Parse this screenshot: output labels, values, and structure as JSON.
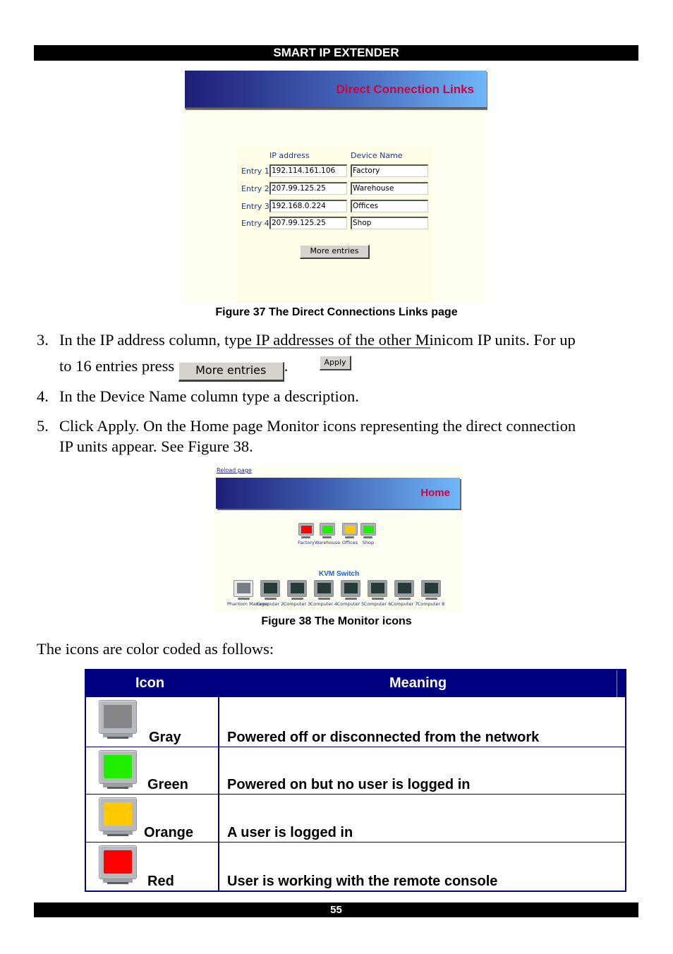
{
  "header": {
    "title": "SMART IP EXTENDER"
  },
  "figure37": {
    "banner_title": "Direct Connection Links",
    "column_headers": {
      "ip": "IP address",
      "name": "Device Name"
    },
    "entries": [
      {
        "label": "Entry 1",
        "ip": "192.114.161.106",
        "name": "Factory"
      },
      {
        "label": "Entry 2",
        "ip": "207.99.125.25",
        "name": "Warehouse"
      },
      {
        "label": "Entry 3",
        "ip": "192.168.0.224",
        "name": "Offices"
      },
      {
        "label": "Entry 4",
        "ip": "207.99.125.25",
        "name": "Shop"
      }
    ],
    "more_entries_label": "More entries",
    "apply_label": "Apply",
    "caption": "Figure 37 The Direct Connections Links page"
  },
  "steps": [
    {
      "number": "3.",
      "text_before": "In the IP address column, type IP addresses of the other Minicom IP units. For up",
      "text_line2": "to 16 entries press",
      "button_label": "More entries",
      "text_after": "."
    },
    {
      "number": "4.",
      "text": "In the Device Name column type a description."
    },
    {
      "number": "5.",
      "text_line1": "Click Apply. On the Home page Monitor icons representing the direct connection",
      "text_line2": "IP units appear. See Figure 38."
    }
  ],
  "figure38": {
    "reload_link": "Reload page",
    "banner_title": "Home",
    "direct_devices": [
      {
        "name": "Factory",
        "status": "red",
        "color": "#ff0000"
      },
      {
        "name": "Warehouse",
        "status": "green",
        "color": "#22ee00"
      },
      {
        "name": "Offices",
        "status": "orange",
        "color": "#ffc800"
      },
      {
        "name": "Shop",
        "status": "green",
        "color": "#22ee00"
      }
    ],
    "kvm_title": "KVM Switch",
    "kvm_devices": [
      {
        "name": "Phantom Manager",
        "color": "#7a7e82"
      },
      {
        "name": "Computer 2",
        "color": "#263a38"
      },
      {
        "name": "Computer 3",
        "color": "#263a38"
      },
      {
        "name": "Computer 4",
        "color": "#263a38"
      },
      {
        "name": "Computer 5",
        "color": "#263a38"
      },
      {
        "name": "Computer 6",
        "color": "#263a38"
      },
      {
        "name": "Computer 7",
        "color": "#263a38"
      },
      {
        "name": "Computer 8",
        "color": "#263a38"
      }
    ],
    "caption": "Figure 38 The Monitor icons"
  },
  "intro": "The icons are color coded as follows:",
  "legend": {
    "headers": {
      "icon": "Icon",
      "meaning": "Meaning"
    },
    "rows": [
      {
        "color_name": "Gray",
        "screen_color": "#878787",
        "meaning": "Powered off or disconnected from the network"
      },
      {
        "color_name": "Green",
        "screen_color": "#22ee00",
        "meaning": "Powered on but no user is logged in"
      },
      {
        "color_name": "Orange",
        "screen_color": "#ffc800",
        "meaning": "A user is logged in"
      },
      {
        "color_name": "Red",
        "screen_color": "#ff0000",
        "meaning": "User is working with the remote console"
      }
    ]
  },
  "footer": {
    "page_number": "55"
  }
}
